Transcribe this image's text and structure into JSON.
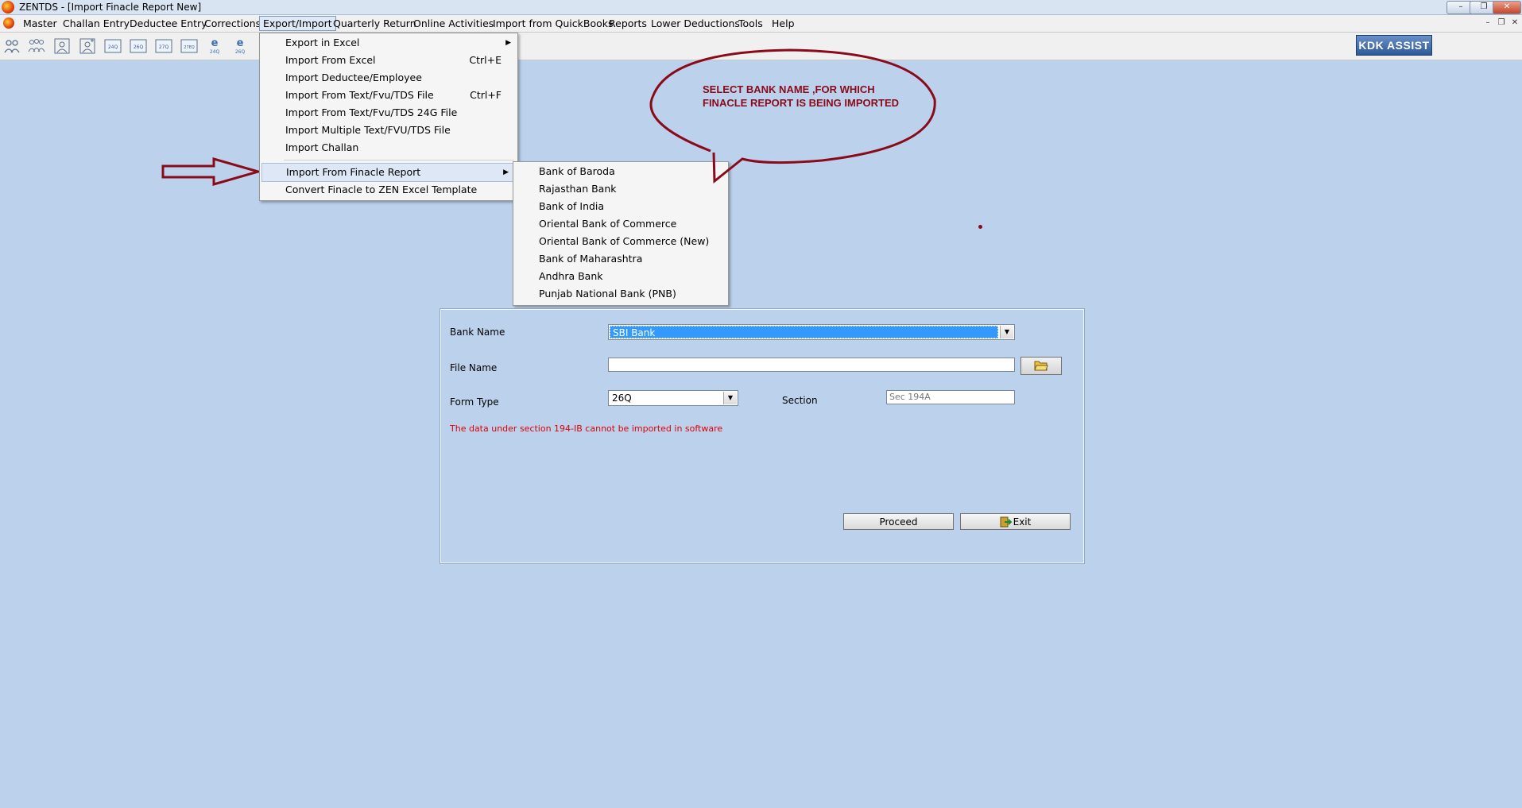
{
  "window": {
    "title": "ZENTDS - [Import Finacle Report New]"
  },
  "menubar": {
    "items": [
      "Master",
      "Challan Entry",
      "Deductee Entry",
      "Corrections",
      "Export/Import",
      "Quarterly Return",
      "Online Activities",
      "Import from QuickBooks",
      "Reports",
      "Lower Deductions",
      "Tools",
      "Help"
    ],
    "active": "Export/Import"
  },
  "toolbar": {
    "icons": [
      "deductor-icon",
      "deductees-icon",
      "user-icon",
      "user-add-icon",
      "form-24q-icon",
      "form-26q-icon",
      "form-27q-icon",
      "form-27eq-icon",
      "e-24q-icon",
      "e-26q-icon"
    ],
    "icon_labels": [
      "",
      "",
      "",
      "",
      "24Q",
      "26Q",
      "27Q",
      "27EQ",
      "24Q",
      "26Q"
    ],
    "kdk_assist": "KDK ASSIST"
  },
  "export_menu": {
    "items": [
      {
        "label": "Export in Excel",
        "shortcut": "",
        "submenu": true
      },
      {
        "label": "Import From Excel",
        "shortcut": "Ctrl+E",
        "submenu": false
      },
      {
        "label": "Import Deductee/Employee",
        "shortcut": "",
        "submenu": false
      },
      {
        "label": "Import From Text/Fvu/TDS File",
        "shortcut": "Ctrl+F",
        "submenu": false
      },
      {
        "label": "Import From Text/Fvu/TDS 24G File",
        "shortcut": "",
        "submenu": false
      },
      {
        "label": "Import Multiple Text/FVU/TDS File",
        "shortcut": "",
        "submenu": false
      },
      {
        "label": "Import Challan",
        "shortcut": "",
        "submenu": false
      },
      {
        "label": "Import From Finacle Report",
        "shortcut": "",
        "submenu": true
      },
      {
        "label": "Convert Finacle to ZEN Excel Template",
        "shortcut": "",
        "submenu": false
      }
    ]
  },
  "finacle_submenu": {
    "items": [
      "Bank of Baroda",
      "Rajasthan Bank",
      "Bank of India",
      "Oriental Bank of Commerce",
      "Oriental Bank of Commerce (New)",
      "Bank of Maharashtra",
      "Andhra Bank",
      "Punjab National Bank (PNB)"
    ]
  },
  "callout": {
    "line1": "SELECT BANK NAME ,FOR WHICH",
    "line2": "FINACLE REPORT IS BEING IMPORTED"
  },
  "form": {
    "bank_name_label": "Bank Name",
    "bank_name_value": "SBI Bank",
    "file_name_label": "File Name",
    "file_name_value": "",
    "form_type_label": "Form Type",
    "form_type_value": "26Q",
    "section_label": "Section",
    "section_value": "Sec 194A",
    "warning": "The data under section 194-IB cannot be imported in software",
    "proceed_label": "Proceed",
    "exit_label": "Exit"
  },
  "colors": {
    "background": "#bcd1ec",
    "selection": "#3399ff",
    "annotation": "#8b0a1a",
    "warning": "#e00000"
  }
}
